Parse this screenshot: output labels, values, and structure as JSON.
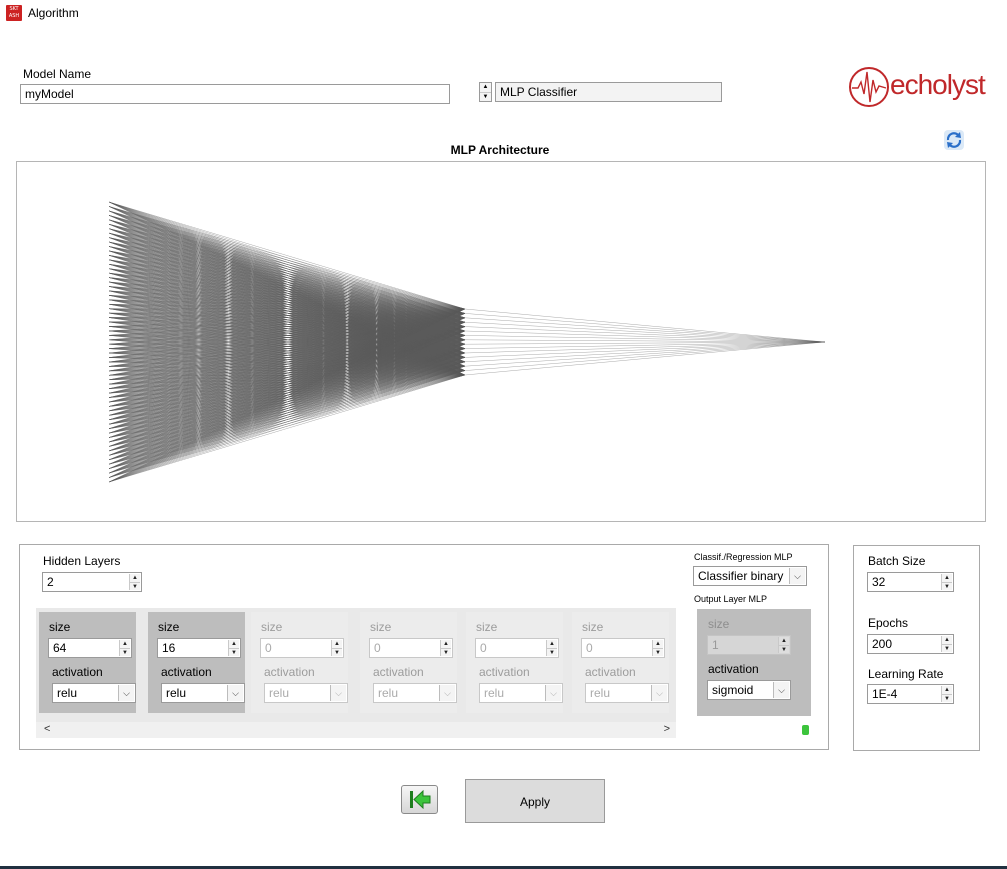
{
  "window": {
    "title": "Algorithm",
    "app_icon": "app-logo-icon"
  },
  "model_name": {
    "label": "Model Name",
    "value": "myModel"
  },
  "algorithm_selector": {
    "value": "MLP Classifier"
  },
  "brand": {
    "logo_text": "echolyst",
    "color": "#c0282a"
  },
  "architecture": {
    "title": "MLP Architecture",
    "line_color": "#5a5a5a",
    "layer_sizes": [
      64,
      16,
      1
    ]
  },
  "hidden_layers": {
    "label": "Hidden Layers",
    "value": "2",
    "layers": [
      {
        "size_label": "size",
        "size": "64",
        "activation_label": "activation",
        "activation": "relu",
        "enabled": true
      },
      {
        "size_label": "size",
        "size": "16",
        "activation_label": "activation",
        "activation": "relu",
        "enabled": true
      },
      {
        "size_label": "size",
        "size": "0",
        "activation_label": "activation",
        "activation": "relu",
        "enabled": false
      },
      {
        "size_label": "size",
        "size": "0",
        "activation_label": "activation",
        "activation": "relu",
        "enabled": false
      },
      {
        "size_label": "size",
        "size": "0",
        "activation_label": "activation",
        "activation": "relu",
        "enabled": false
      },
      {
        "size_label": "size",
        "size": "0",
        "activation_label": "activation",
        "activation": "relu",
        "enabled": false
      }
    ]
  },
  "mlp_type": {
    "label": "Classif./Regression MLP",
    "value": "Classifier binary"
  },
  "output_layer": {
    "label": "Output Layer MLP",
    "size_label": "size",
    "size": "1",
    "activation_label": "activation",
    "activation": "sigmoid",
    "indicator_color": "#3cc43c"
  },
  "training": {
    "batch_size_label": "Batch Size",
    "batch_size": "32",
    "epochs_label": "Epochs",
    "epochs": "200",
    "learning_rate_label": "Learning Rate",
    "learning_rate": "1E-4"
  },
  "buttons": {
    "back_icon": "back-arrow-icon",
    "apply_label": "Apply"
  }
}
